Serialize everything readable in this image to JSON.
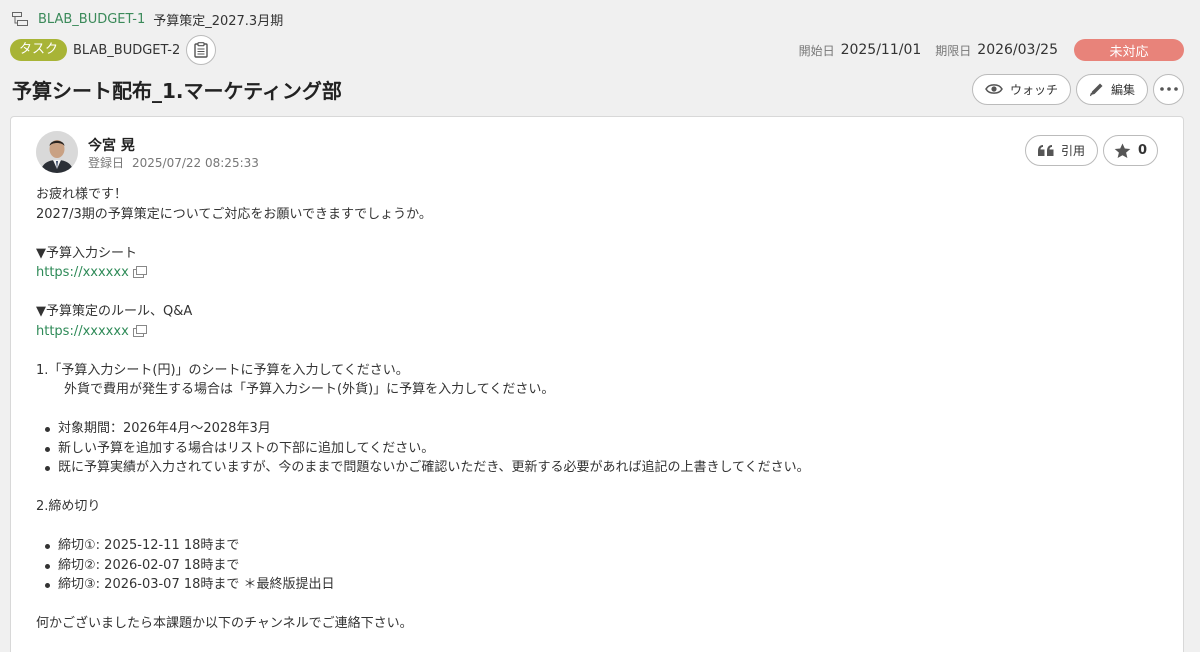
{
  "parent": {
    "key": "BLAB_BUDGET-1",
    "title": "予算策定_2027.3月期"
  },
  "issue": {
    "type": "タスク",
    "key": "BLAB_BUDGET-2",
    "start_label": "開始日",
    "start_date": "2025/11/01",
    "due_label": "期限日",
    "due_date": "2026/03/25",
    "status": "未対応",
    "title": "予算シート配布_1.マーケティング部"
  },
  "actions": {
    "watch": "ウォッチ",
    "edit": "編集",
    "quote": "引用",
    "star_count": "0"
  },
  "author": {
    "name": "今宮 晃",
    "reg_label": "登録日",
    "reg_date": "2025/07/22 08:25:33"
  },
  "body": {
    "greeting": "お疲れ様です！",
    "request": "2027/3期の予算策定についてご対応をお願いできますでしょうか。",
    "section_input": "▼予算入力シート",
    "link1": "https://xxxxxx",
    "section_rules": "▼予算策定のルール、Q&A",
    "link2": "https://xxxxxx",
    "item1": "1.「予算入力シート(円)」のシートに予算を入力してください。",
    "item1_sub": "外貨で費用が発生する場合は「予算入力シート(外貨)」に予算を入力してください。",
    "bullets1": [
      "対象期間：2026年4月〜2028年3月",
      "新しい予算を追加する場合はリストの下部に追加してください。",
      "既に予算実績が入力されていますが、今のままで問題ないかご確認いただき、更新する必要があれば追記の上書きしてください。"
    ],
    "item2": "2.締め切り",
    "bullets2": [
      "締切①: 2025-12-11 18時まで",
      "締切②: 2026-02-07 18時まで",
      "締切③: 2026-03-07 18時まで ＊最終版提出日"
    ],
    "closing": "何かございましたら本課題か以下のチャンネルでご連絡下さい。"
  },
  "colors": {
    "accent_green": "#3b8a5a",
    "type_badge": "#a8b436",
    "status_badge": "#e8837a"
  }
}
